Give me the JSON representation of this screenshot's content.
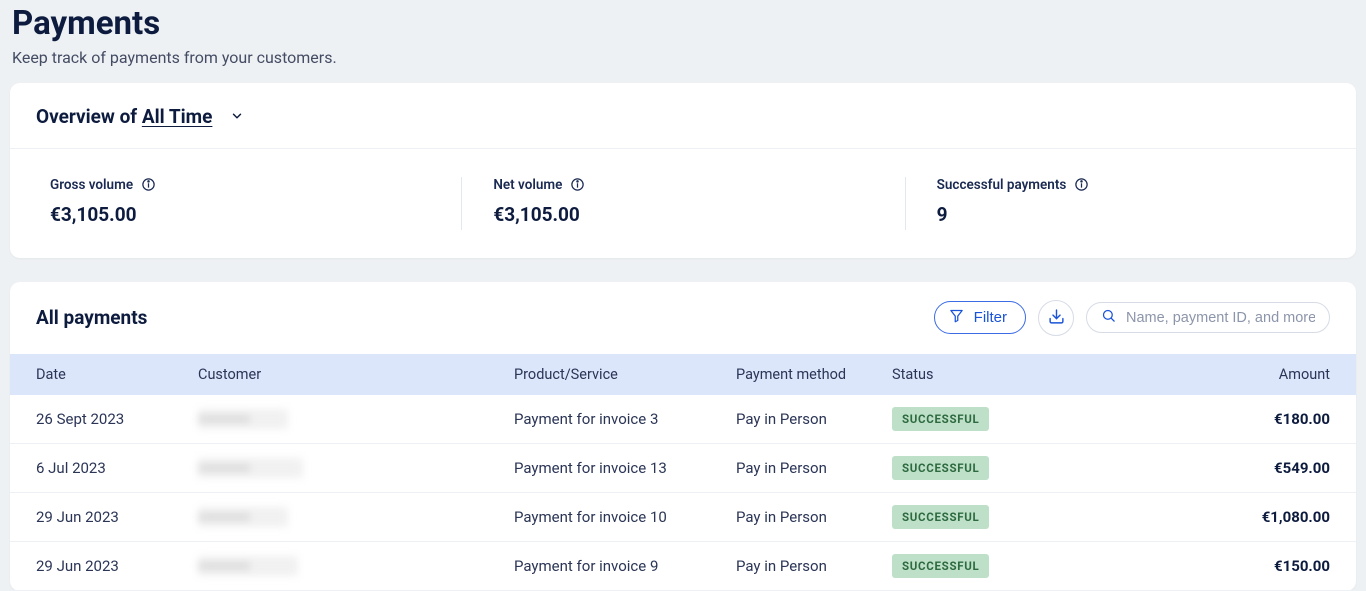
{
  "header": {
    "title": "Payments",
    "subtitle": "Keep track of payments from your customers."
  },
  "overview": {
    "prefix": "Overview of ",
    "period": "All Time",
    "metrics": [
      {
        "label": "Gross volume",
        "value": "€3,105.00"
      },
      {
        "label": "Net volume",
        "value": "€3,105.00"
      },
      {
        "label": "Successful payments",
        "value": "9"
      }
    ]
  },
  "toolbar": {
    "title": "All payments",
    "filter_label": "Filter",
    "search_placeholder": "Name, payment ID, and more"
  },
  "table": {
    "columns": {
      "date": "Date",
      "customer": "Customer",
      "product": "Product/Service",
      "method": "Payment method",
      "status": "Status",
      "amount": "Amount"
    },
    "rows": [
      {
        "date": "26 Sept 2023",
        "customer": "",
        "product": "Payment for invoice 3",
        "method": "Pay in Person",
        "status": "SUCCESSFUL",
        "amount": "€180.00"
      },
      {
        "date": "6 Jul 2023",
        "customer": "",
        "product": "Payment for invoice 13",
        "method": "Pay in Person",
        "status": "SUCCESSFUL",
        "amount": "€549.00"
      },
      {
        "date": "29 Jun 2023",
        "customer": "",
        "product": "Payment for invoice 10",
        "method": "Pay in Person",
        "status": "SUCCESSFUL",
        "amount": "€1,080.00"
      },
      {
        "date": "29 Jun 2023",
        "customer": "",
        "product": "Payment for invoice 9",
        "method": "Pay in Person",
        "status": "SUCCESSFUL",
        "amount": "€150.00"
      }
    ]
  }
}
